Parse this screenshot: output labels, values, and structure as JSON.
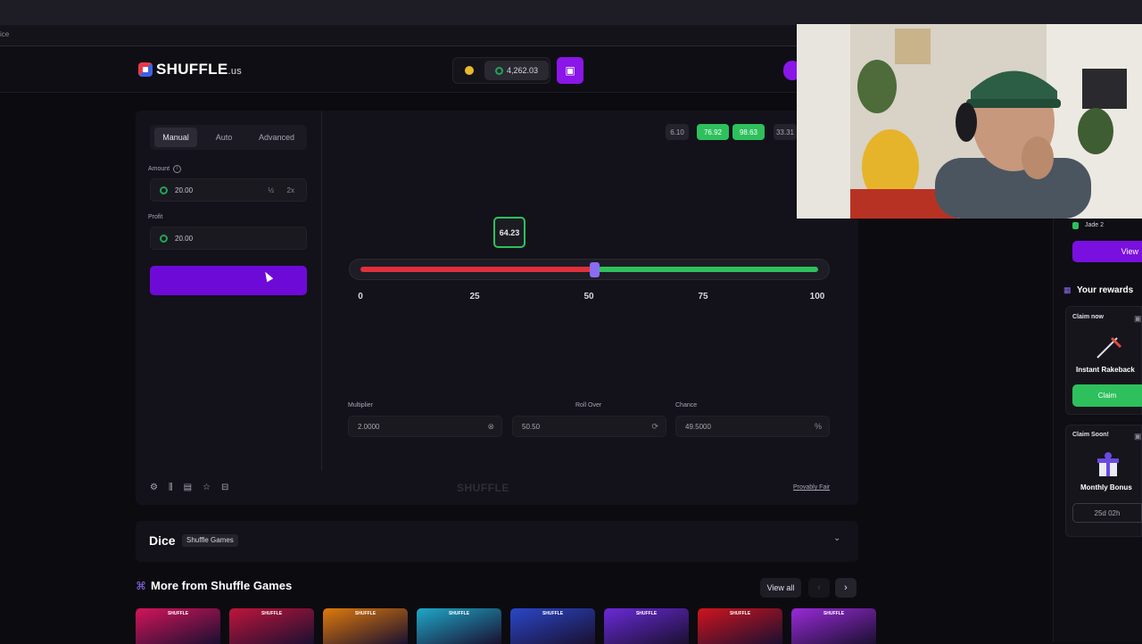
{
  "browser": {
    "url_fragment": "ice"
  },
  "header": {
    "logo_text": "SHUFFLE",
    "logo_suffix": ".us",
    "balance": "4,262.03"
  },
  "game": {
    "tabs": [
      "Manual",
      "Auto",
      "Advanced"
    ],
    "active_tab": "Manual",
    "amount_label": "Amount",
    "amount_value": "20.00",
    "half_label": "½",
    "double_label": "2x",
    "profit_label": "Profit",
    "profit_value": "20.00",
    "bet_label": "",
    "recent_results": [
      "6.10",
      "76.92",
      "98.63",
      "33.31"
    ],
    "result_marker": "64.23",
    "roll_over_fraction": 0.505,
    "scale_ticks": [
      "0",
      "25",
      "50",
      "75",
      "100"
    ],
    "multiplier_label": "Multiplier",
    "multiplier_value": "2.0000",
    "rollover_label": "Roll Over",
    "rollover_value": "50.50",
    "chance_label": "Chance",
    "chance_value": "49.5000",
    "chance_unit": "%",
    "watermark": "SHUFFLE",
    "provably_fair": "Provably Fair"
  },
  "description": {
    "title": "Dice",
    "provider": "Shuffle Games"
  },
  "more_games": {
    "title": "More from Shuffle Games",
    "view_all": "View all",
    "thumb_brand": "SHUFFLE",
    "thumb_colors": [
      "#d4145a",
      "#c0143c",
      "#e07a0a",
      "#1fa8c9",
      "#2a47c9",
      "#6a2ad8",
      "#d0141e",
      "#9a2ad8"
    ]
  },
  "right_panel": {
    "level": "Jade 2",
    "view_label": "View",
    "rewards_title": "Your rewards",
    "claim_now": "Claim now",
    "rakeback_title": "Instant Rakeback",
    "claim_label": "Claim",
    "claim_soon": "Claim Soon!",
    "monthly_title": "Monthly Bonus",
    "timer": "25d 02h"
  },
  "colors": {
    "accent": "#6e0ad8",
    "win": "#2ec05c",
    "lose": "#e0303c"
  }
}
